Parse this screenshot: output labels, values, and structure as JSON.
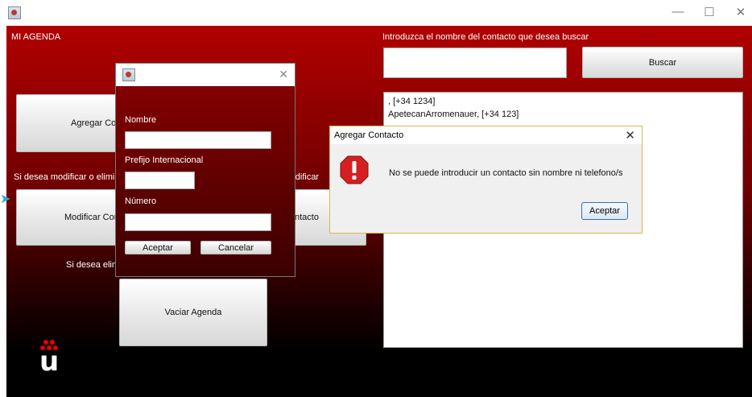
{
  "window": {
    "minimize_glyph": "—",
    "maximize_glyph": "☐",
    "close_glyph": "✕"
  },
  "main": {
    "title": "MI AGENDA",
    "search_label": "Introduzca el nombre del contacto que desea buscar",
    "search_value": "",
    "buscar_label": "Buscar",
    "add_button_label": "Agregar Contacto",
    "modify_text": "Si desea modificar o eliminar un contacto búsquelo y despues pulse Modificar",
    "modify_button_label": "Modificar Contacto",
    "hidden_button_fragment": "ntacto",
    "clear_text": "Si desea eliminar todos los contactos pulse Vaciar Agenda",
    "clear_button_label": "Vaciar Agenda",
    "contacts": [
      ", [+34 1234]",
      "ApetecanArromenauer, [+34 123]"
    ]
  },
  "add_dialog": {
    "close_glyph": "✕",
    "nombre_label": "Nombre",
    "prefijo_label": "Prefijo Internacional",
    "numero_label": "Número",
    "aceptar_label": "Aceptar",
    "cancelar_label": "Cancelar"
  },
  "error_dialog": {
    "title": "Agregar Contacto",
    "close_glyph": "✕",
    "message": "No se puede introducir un contacto sin nombre ni telefono/s",
    "ok_label": "Aceptar"
  },
  "colors": {
    "brand_red": "#b00000",
    "dialog_border": "#d9b94a",
    "error_icon": "#d42020"
  }
}
